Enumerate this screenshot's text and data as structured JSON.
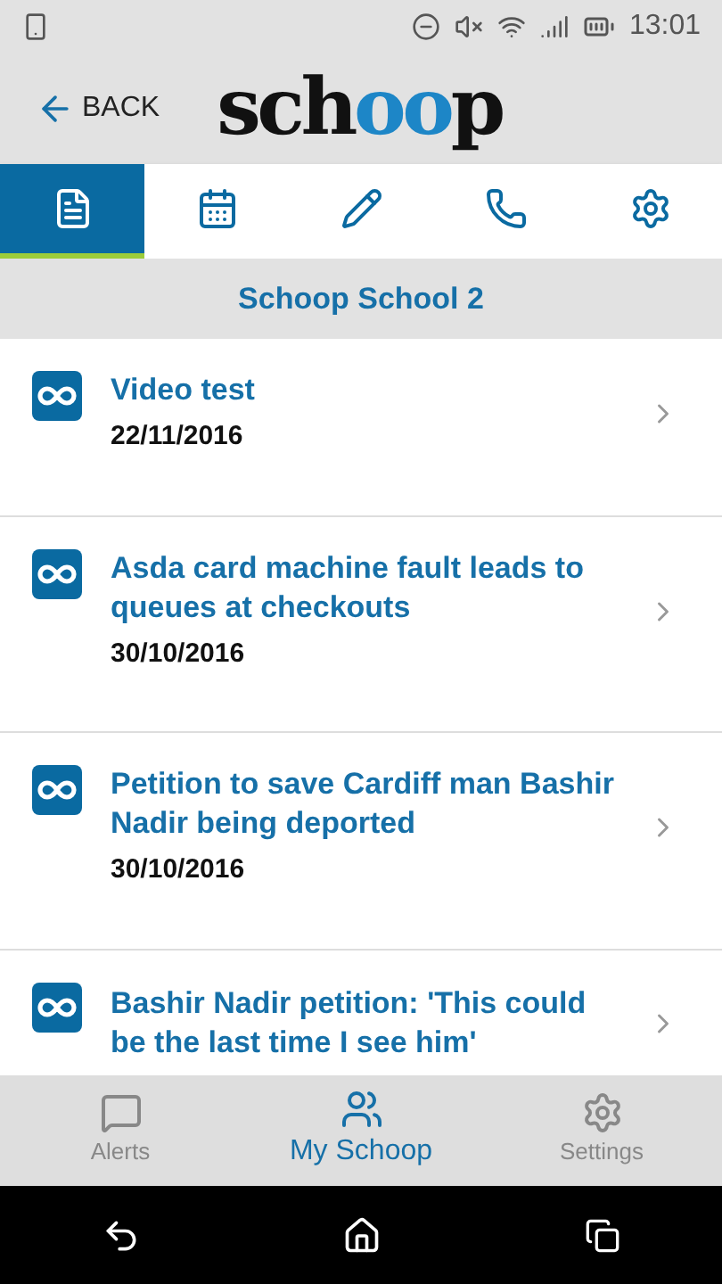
{
  "status_bar": {
    "time": "13:01"
  },
  "header": {
    "back": "BACK",
    "logo": [
      {
        "text": "sch",
        "accent": false
      },
      {
        "text": "oo",
        "accent": true
      },
      {
        "text": "p",
        "accent": false
      }
    ]
  },
  "tabs": [
    {
      "kind": "document",
      "selected": true
    },
    {
      "kind": "calendar",
      "selected": false
    },
    {
      "kind": "pencil",
      "selected": false
    },
    {
      "kind": "phone",
      "selected": false
    },
    {
      "kind": "gear",
      "selected": false
    }
  ],
  "school": "Schoop School 2",
  "items": [
    {
      "title": "Video test",
      "date": "22/11/2016"
    },
    {
      "title": "Asda card machine fault leads to queues at checkouts",
      "date": "30/10/2016"
    },
    {
      "title": "Petition to save Cardiff man Bashir Nadir being deported",
      "date": "30/10/2016"
    },
    {
      "title": "Bashir Nadir petition: 'This could be the last time I see him'"
    }
  ],
  "bottom_nav": [
    {
      "kind": "chat",
      "label": "Alerts",
      "selected": false
    },
    {
      "kind": "people",
      "label": "My Schoop",
      "selected": true
    },
    {
      "kind": "gear",
      "label": "Settings",
      "selected": false
    }
  ]
}
